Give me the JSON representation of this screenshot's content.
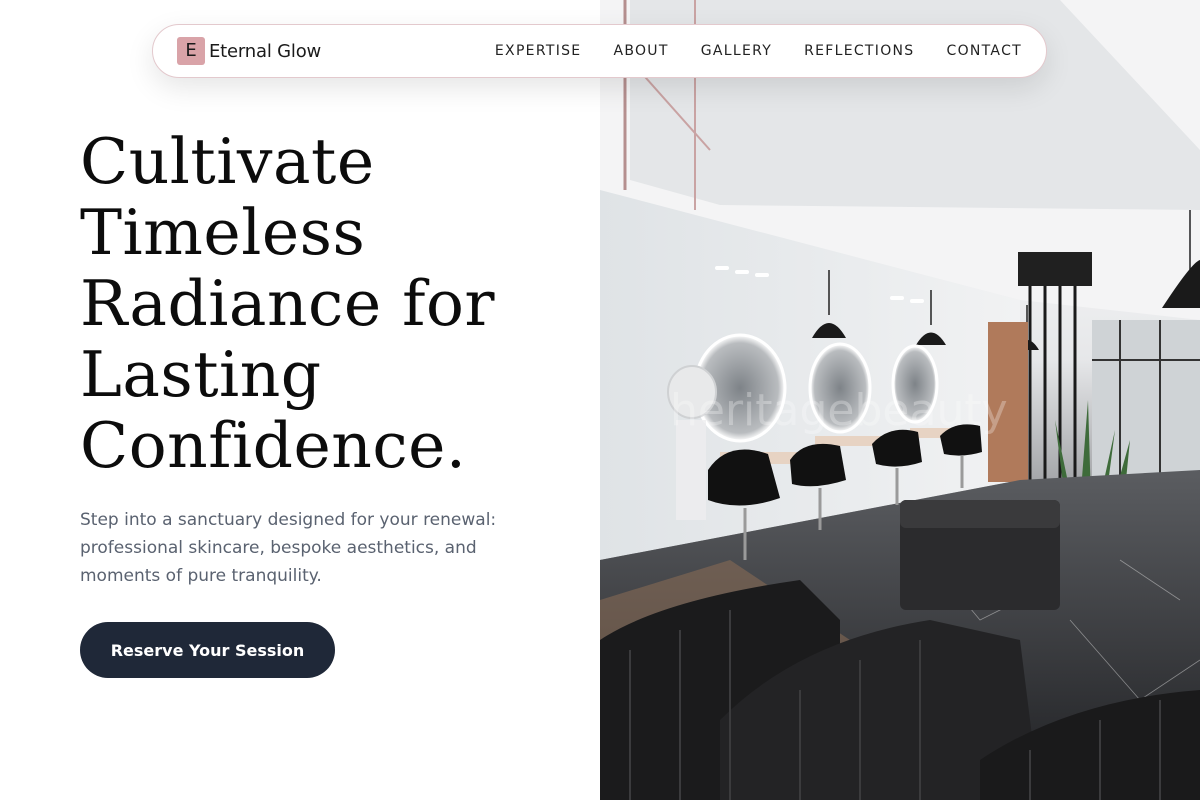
{
  "brand": {
    "mark": "E",
    "name": "Eternal Glow"
  },
  "nav": {
    "items": [
      {
        "label": "EXPERTISE"
      },
      {
        "label": "ABOUT"
      },
      {
        "label": "GALLERY"
      },
      {
        "label": "REFLECTIONS"
      },
      {
        "label": "CONTACT"
      }
    ]
  },
  "hero": {
    "title_lines": [
      "Cultivate",
      "Timeless",
      "Radiance for",
      "Lasting",
      "Confidence."
    ],
    "subtitle": "Step into a sanctuary designed for your renewal: professional skincare, bespoke aesthetics, and moments of pure tranquility.",
    "cta_label": "Reserve Your Session"
  },
  "colors": {
    "accent": "#d9a3a8",
    "button": "#1f2838",
    "nav_border": "#e3c9cd",
    "subtitle_text": "#5a6270"
  }
}
